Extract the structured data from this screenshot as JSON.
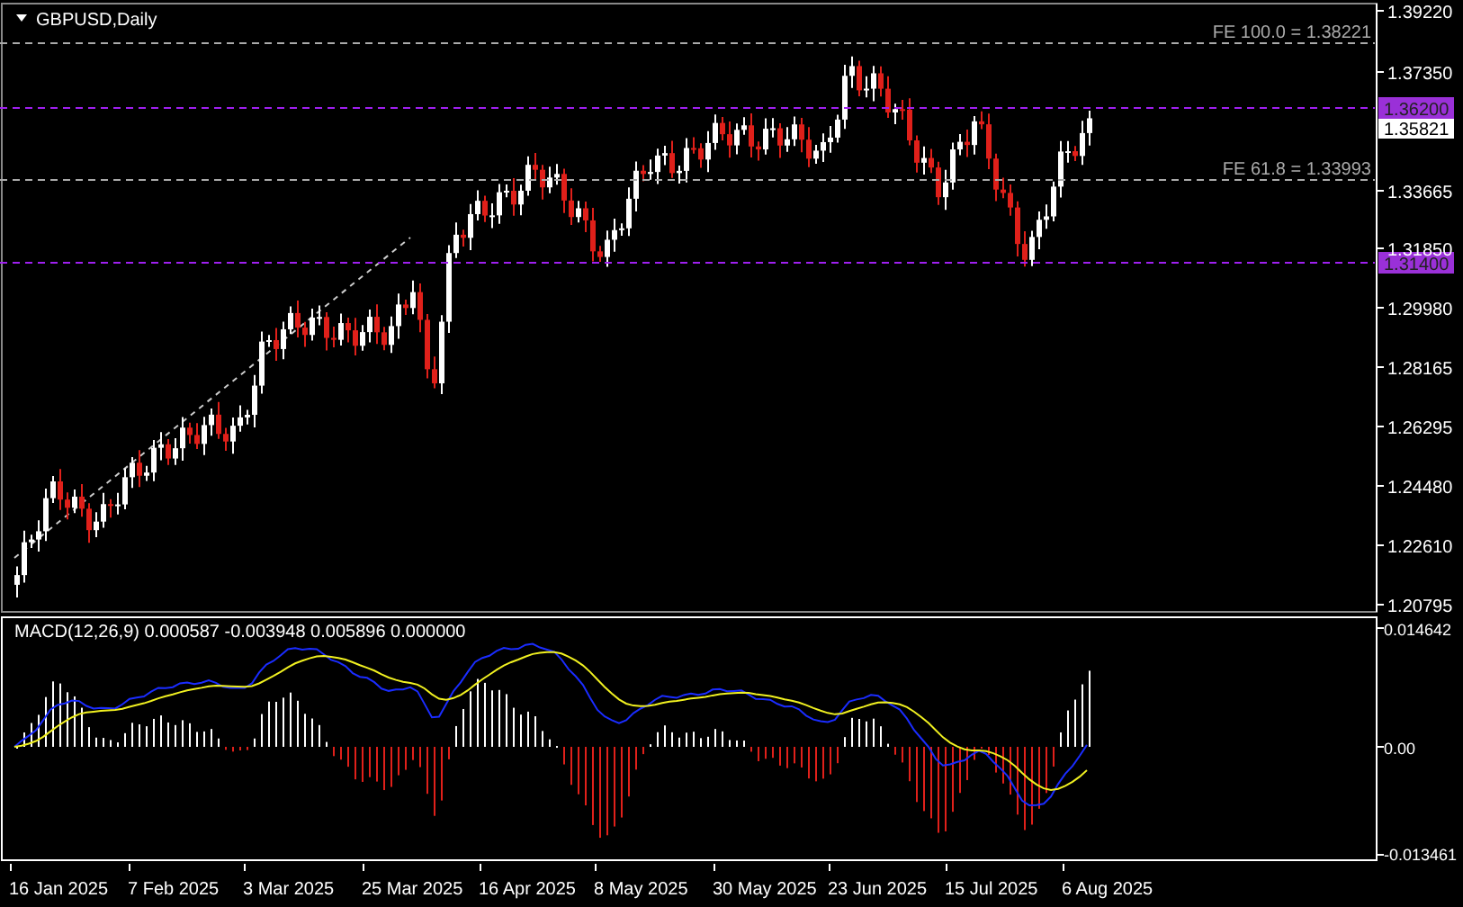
{
  "chart": {
    "title": "GBPUSD,Daily",
    "price_axis": [
      "1.39220",
      "1.37350",
      "1.33665",
      "1.31850",
      "1.29980",
      "1.28165",
      "1.26295",
      "1.24480",
      "1.22610",
      "1.20795"
    ],
    "levels": [
      {
        "kind": "fibo",
        "label": "FE 100.0 = 1.38221"
      },
      {
        "kind": "line",
        "label": "1.36200"
      },
      {
        "kind": "fibo",
        "label": "FE 61.8 = 1.33993"
      },
      {
        "kind": "line",
        "label": "1.31400"
      }
    ],
    "current_price": "1.35821"
  },
  "macd": {
    "label": "MACD(12,26,9) 0.000587 -0.003948 0.005896 0.000000",
    "axis": [
      "0.014642",
      "0.00",
      "-0.013461"
    ]
  },
  "time_axis": [
    "16 Jan 2025",
    "7 Feb 2025",
    "3 Mar 2025",
    "25 Mar 2025",
    "16 Apr 2025",
    "8 May 2025",
    "30 May 2025",
    "23 Jun 2025",
    "15 Jul 2025",
    "6 Aug 2025"
  ]
}
